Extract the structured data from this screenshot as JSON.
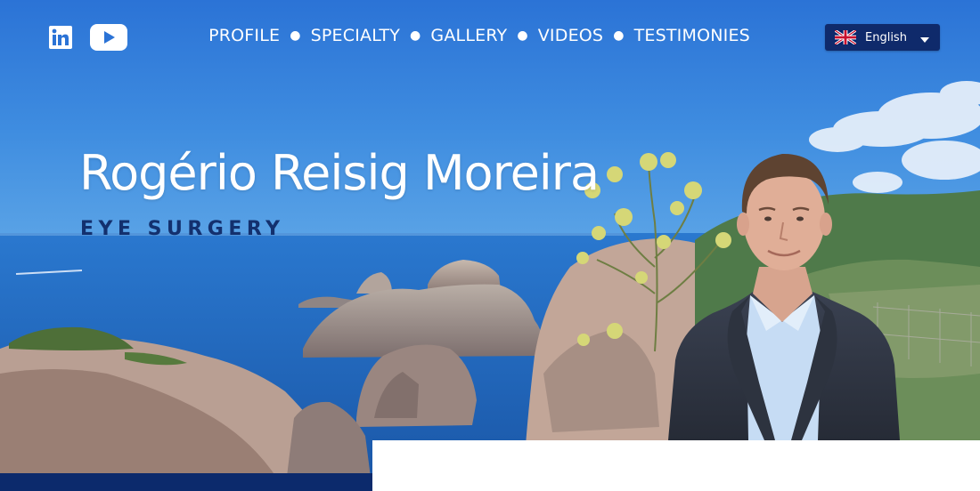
{
  "header": {
    "social": [
      {
        "name": "linkedin-icon",
        "label": "in"
      },
      {
        "name": "youtube-icon"
      }
    ],
    "nav": [
      {
        "label": "PROFILE"
      },
      {
        "label": "SPECIALTY"
      },
      {
        "label": "GALLERY"
      },
      {
        "label": "VIDEOS"
      },
      {
        "label": "TESTIMONIES"
      }
    ],
    "language": {
      "label": "English",
      "flag_icon": "uk-flag-icon",
      "caret_icon": "caret-down-icon"
    }
  },
  "hero": {
    "title": "Rogério Reisig Moreira",
    "subtitle": "EYE SURGERY"
  },
  "colors": {
    "sky": "#2d7ad8",
    "sea": "#1d5fb0",
    "nav_text": "#ffffff",
    "subtitle": "#13306e",
    "lang_bg": "#0f2a6b",
    "bottom_bar": "#0c2a6c"
  }
}
